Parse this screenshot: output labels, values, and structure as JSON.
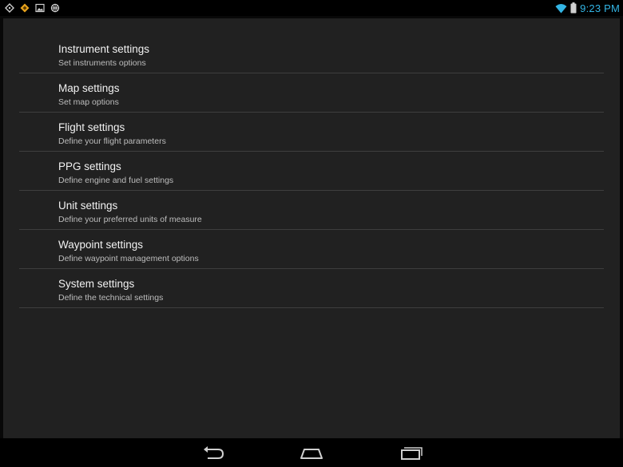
{
  "status_bar": {
    "time": "9:23 PM",
    "clock_color": "#33b5e5",
    "notification_icons": [
      "gps-icon",
      "app-diamond-icon",
      "gallery-icon",
      "sync-icon"
    ],
    "system_icons": [
      "wifi-icon",
      "battery-icon"
    ]
  },
  "settings": {
    "items": [
      {
        "title": "Instrument settings",
        "summary": "Set instruments options"
      },
      {
        "title": "Map settings",
        "summary": "Set map options"
      },
      {
        "title": "Flight settings",
        "summary": "Define your flight parameters"
      },
      {
        "title": "PPG settings",
        "summary": "Define engine and fuel settings"
      },
      {
        "title": "Unit settings",
        "summary": "Define your preferred units of measure"
      },
      {
        "title": "Waypoint settings",
        "summary": "Define waypoint management options"
      },
      {
        "title": "System settings",
        "summary": "Define the technical settings"
      }
    ]
  },
  "nav_bar": {
    "buttons": [
      "back-icon",
      "home-icon",
      "recent-apps-icon"
    ]
  }
}
